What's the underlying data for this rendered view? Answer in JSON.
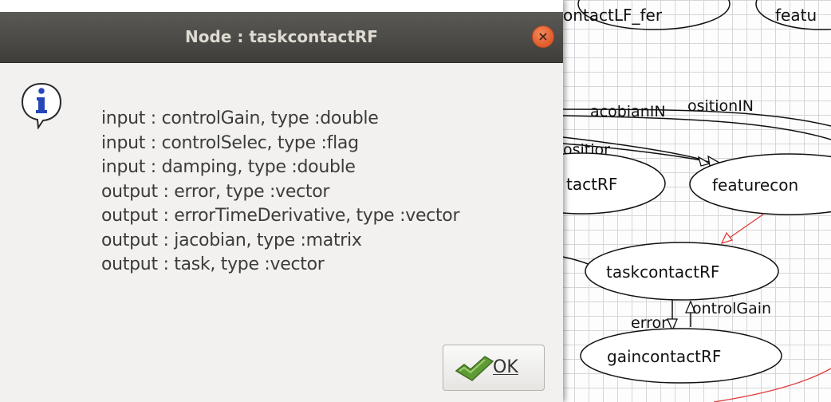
{
  "dialog": {
    "title": "Node : taskcontactRF",
    "close_symbol": "×",
    "icon": "info-icon",
    "lines": [
      "input : controlGain, type :double",
      "input : controlSelec, type :flag",
      "input : damping, type :double",
      "output : error, type :vector",
      "output : errorTimeDerivative, type :vector",
      "output : jacobian, type :matrix",
      "output : task, type :vector"
    ],
    "ok_icon": "ok-check-icon",
    "ok_label": "OK"
  },
  "graph": {
    "top_labels": [
      "ontactLF_fer",
      "featu"
    ],
    "nodes": [
      "tactRF",
      "featurecon",
      "taskcontactRF",
      "gaincontactRF"
    ],
    "edges": [
      "acobianIN",
      "ositionIN",
      "ositior",
      "ontrolGain",
      "error"
    ]
  },
  "colors": {
    "titlebar": "#4d4c48",
    "close_button": "#e8652f",
    "dialog_bg": "#f2f1f0",
    "red_edge": "#e03a3a"
  }
}
